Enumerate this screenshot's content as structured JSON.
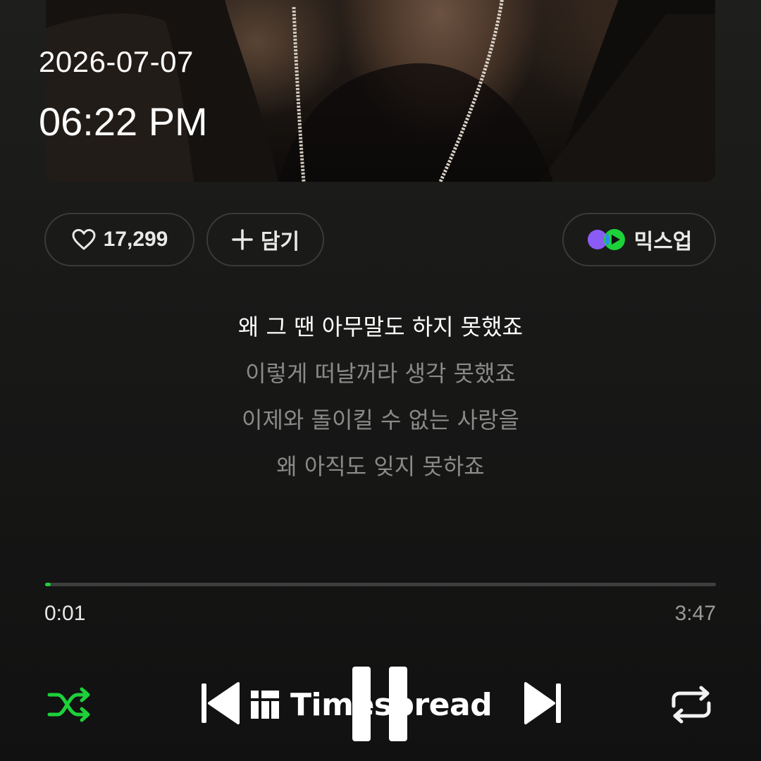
{
  "status": {
    "date": "2026-07-07",
    "time": "06:22 PM"
  },
  "album_art": {
    "icon": "album-art-image"
  },
  "actions": {
    "like_count": "17,299",
    "like_icon": "heart-outline-icon",
    "add_label": "담기",
    "add_icon": "plus-icon",
    "mixup_label": "믹스업",
    "mixup_icon": "mixup-logo-icon"
  },
  "lyrics": {
    "lines": [
      "왜 그 땐 아무말도 하지 못했죠",
      "이렇게 떠날꺼라 생각 못했죠",
      "이제와 돌이킬 수 없는 사랑을",
      "왜 아직도 잊지 못하죠"
    ],
    "current_index": 0
  },
  "player": {
    "elapsed": "0:01",
    "total": "3:47",
    "progress_fraction": 0.005,
    "accent_color": "#1dd13a",
    "controls": [
      "shuffle-icon",
      "previous-icon",
      "pause-icon",
      "next-icon",
      "repeat-icon"
    ]
  },
  "watermark": {
    "text": "Timespread",
    "icon": "timespread-logo-icon"
  }
}
